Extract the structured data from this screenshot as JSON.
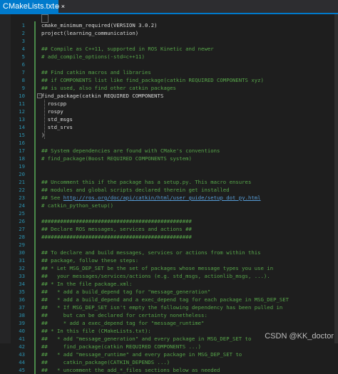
{
  "tab": {
    "title": "CMakeLists.txt",
    "pin_glyph": "⊕",
    "close_glyph": "×"
  },
  "lines": [
    {
      "n": "1",
      "t": "cmake_minimum_required(VERSION 3.0.2)",
      "k": "code"
    },
    {
      "n": "2",
      "t": "project(learning_communication)",
      "k": "code"
    },
    {
      "n": "3",
      "t": "",
      "k": "code"
    },
    {
      "n": "4",
      "t": "## Compile as C++11, supported in ROS Kinetic and newer",
      "k": "comment"
    },
    {
      "n": "5",
      "t": "# add_compile_options(-std=c++11)",
      "k": "comment"
    },
    {
      "n": "6",
      "t": "",
      "k": "code"
    },
    {
      "n": "7",
      "t": "## Find catkin macros and libraries",
      "k": "comment"
    },
    {
      "n": "8",
      "t": "## if COMPONENTS list like find_package(catkin REQUIRED COMPONENTS xyz)",
      "k": "comment"
    },
    {
      "n": "9",
      "t": "## is used, also find other catkin packages",
      "k": "comment"
    },
    {
      "n": "10",
      "t": "find_package(catkin REQUIRED COMPONENTS",
      "k": "code"
    },
    {
      "n": "11",
      "t": "  roscpp",
      "k": "code"
    },
    {
      "n": "12",
      "t": "  rospy",
      "k": "code"
    },
    {
      "n": "13",
      "t": "  std_msgs",
      "k": "code"
    },
    {
      "n": "14",
      "t": "  std_srvs",
      "k": "code"
    },
    {
      "n": "15",
      "t": ")",
      "k": "code"
    },
    {
      "n": "16",
      "t": "",
      "k": "code"
    },
    {
      "n": "17",
      "t": "## System dependencies are found with CMake's conventions",
      "k": "comment"
    },
    {
      "n": "18",
      "t": "# find_package(Boost REQUIRED COMPONENTS system)",
      "k": "comment"
    },
    {
      "n": "19",
      "t": "",
      "k": "code"
    },
    {
      "n": "20",
      "t": "",
      "k": "code"
    },
    {
      "n": "21",
      "t": "## Uncomment this if the package has a setup.py. This macro ensures",
      "k": "comment"
    },
    {
      "n": "22",
      "t": "## modules and global scripts declared therein get installed",
      "k": "comment"
    },
    {
      "n": "23",
      "t": "## See ",
      "k": "comment",
      "link": "http://ros.org/doc/api/catkin/html/user_guide/setup_dot_py.html"
    },
    {
      "n": "24",
      "t": "# catkin_python_setup()",
      "k": "comment"
    },
    {
      "n": "25",
      "t": "",
      "k": "code"
    },
    {
      "n": "26",
      "t": "################################################",
      "k": "comment"
    },
    {
      "n": "27",
      "t": "## Declare ROS messages, services and actions ##",
      "k": "comment"
    },
    {
      "n": "28",
      "t": "################################################",
      "k": "comment"
    },
    {
      "n": "29",
      "t": "",
      "k": "code"
    },
    {
      "n": "30",
      "t": "## To declare and build messages, services or actions from within this",
      "k": "comment"
    },
    {
      "n": "31",
      "t": "## package, follow these steps:",
      "k": "comment"
    },
    {
      "n": "32",
      "t": "## * Let MSG_DEP_SET be the set of packages whose message types you use in",
      "k": "comment"
    },
    {
      "n": "33",
      "t": "##   your messages/services/actions (e.g. std_msgs, actionlib_msgs, ...).",
      "k": "comment"
    },
    {
      "n": "34",
      "t": "## * In the file package.xml:",
      "k": "comment"
    },
    {
      "n": "35",
      "t": "##   * add a build_depend tag for \"message_generation\"",
      "k": "comment"
    },
    {
      "n": "36",
      "t": "##   * add a build_depend and a exec_depend tag for each package in MSG_DEP_SET",
      "k": "comment"
    },
    {
      "n": "37",
      "t": "##   * If MSG_DEP_SET isn't empty the following dependency has been pulled in",
      "k": "comment"
    },
    {
      "n": "38",
      "t": "##     but can be declared for certainty nonetheless:",
      "k": "comment"
    },
    {
      "n": "39",
      "t": "##     * add a exec_depend tag for \"message_runtime\"",
      "k": "comment"
    },
    {
      "n": "40",
      "t": "## * In this file (CMakeLists.txt):",
      "k": "comment"
    },
    {
      "n": "41",
      "t": "##   * add \"message_generation\" and every package in MSG_DEP_SET to",
      "k": "comment"
    },
    {
      "n": "42",
      "t": "##     find_package(catkin REQUIRED COMPONENTS ...)",
      "k": "comment"
    },
    {
      "n": "43",
      "t": "##   * add \"message_runtime\" and every package in MSG_DEP_SET to",
      "k": "comment"
    },
    {
      "n": "44",
      "t": "##     catkin_package(CATKIN_DEPENDS ...)",
      "k": "comment"
    },
    {
      "n": "45",
      "t": "##   * uncomment the add_*_files sections below as needed",
      "k": "comment"
    }
  ],
  "watermark": "CSDN @KK_doctor",
  "colors": {
    "accent": "#007acc",
    "comment": "#57a64a",
    "line_number": "#2b91af",
    "text": "#dcdcdc",
    "link": "#569cd6"
  },
  "icons": {
    "fold_collapse": "minus-box-icon"
  }
}
